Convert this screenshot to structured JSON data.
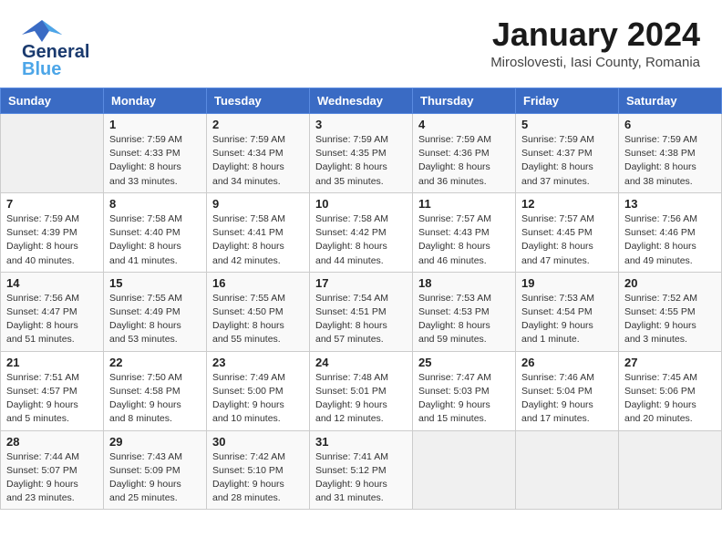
{
  "header": {
    "logo_line1": "General",
    "logo_line2": "Blue",
    "month": "January 2024",
    "location": "Miroslovesti, Iasi County, Romania"
  },
  "weekdays": [
    "Sunday",
    "Monday",
    "Tuesday",
    "Wednesday",
    "Thursday",
    "Friday",
    "Saturday"
  ],
  "weeks": [
    [
      {
        "day": "",
        "sunrise": "",
        "sunset": "",
        "daylight": ""
      },
      {
        "day": "1",
        "sunrise": "Sunrise: 7:59 AM",
        "sunset": "Sunset: 4:33 PM",
        "daylight": "Daylight: 8 hours and 33 minutes."
      },
      {
        "day": "2",
        "sunrise": "Sunrise: 7:59 AM",
        "sunset": "Sunset: 4:34 PM",
        "daylight": "Daylight: 8 hours and 34 minutes."
      },
      {
        "day": "3",
        "sunrise": "Sunrise: 7:59 AM",
        "sunset": "Sunset: 4:35 PM",
        "daylight": "Daylight: 8 hours and 35 minutes."
      },
      {
        "day": "4",
        "sunrise": "Sunrise: 7:59 AM",
        "sunset": "Sunset: 4:36 PM",
        "daylight": "Daylight: 8 hours and 36 minutes."
      },
      {
        "day": "5",
        "sunrise": "Sunrise: 7:59 AM",
        "sunset": "Sunset: 4:37 PM",
        "daylight": "Daylight: 8 hours and 37 minutes."
      },
      {
        "day": "6",
        "sunrise": "Sunrise: 7:59 AM",
        "sunset": "Sunset: 4:38 PM",
        "daylight": "Daylight: 8 hours and 38 minutes."
      }
    ],
    [
      {
        "day": "7",
        "sunrise": "Sunrise: 7:59 AM",
        "sunset": "Sunset: 4:39 PM",
        "daylight": "Daylight: 8 hours and 40 minutes."
      },
      {
        "day": "8",
        "sunrise": "Sunrise: 7:58 AM",
        "sunset": "Sunset: 4:40 PM",
        "daylight": "Daylight: 8 hours and 41 minutes."
      },
      {
        "day": "9",
        "sunrise": "Sunrise: 7:58 AM",
        "sunset": "Sunset: 4:41 PM",
        "daylight": "Daylight: 8 hours and 42 minutes."
      },
      {
        "day": "10",
        "sunrise": "Sunrise: 7:58 AM",
        "sunset": "Sunset: 4:42 PM",
        "daylight": "Daylight: 8 hours and 44 minutes."
      },
      {
        "day": "11",
        "sunrise": "Sunrise: 7:57 AM",
        "sunset": "Sunset: 4:43 PM",
        "daylight": "Daylight: 8 hours and 46 minutes."
      },
      {
        "day": "12",
        "sunrise": "Sunrise: 7:57 AM",
        "sunset": "Sunset: 4:45 PM",
        "daylight": "Daylight: 8 hours and 47 minutes."
      },
      {
        "day": "13",
        "sunrise": "Sunrise: 7:56 AM",
        "sunset": "Sunset: 4:46 PM",
        "daylight": "Daylight: 8 hours and 49 minutes."
      }
    ],
    [
      {
        "day": "14",
        "sunrise": "Sunrise: 7:56 AM",
        "sunset": "Sunset: 4:47 PM",
        "daylight": "Daylight: 8 hours and 51 minutes."
      },
      {
        "day": "15",
        "sunrise": "Sunrise: 7:55 AM",
        "sunset": "Sunset: 4:49 PM",
        "daylight": "Daylight: 8 hours and 53 minutes."
      },
      {
        "day": "16",
        "sunrise": "Sunrise: 7:55 AM",
        "sunset": "Sunset: 4:50 PM",
        "daylight": "Daylight: 8 hours and 55 minutes."
      },
      {
        "day": "17",
        "sunrise": "Sunrise: 7:54 AM",
        "sunset": "Sunset: 4:51 PM",
        "daylight": "Daylight: 8 hours and 57 minutes."
      },
      {
        "day": "18",
        "sunrise": "Sunrise: 7:53 AM",
        "sunset": "Sunset: 4:53 PM",
        "daylight": "Daylight: 8 hours and 59 minutes."
      },
      {
        "day": "19",
        "sunrise": "Sunrise: 7:53 AM",
        "sunset": "Sunset: 4:54 PM",
        "daylight": "Daylight: 9 hours and 1 minute."
      },
      {
        "day": "20",
        "sunrise": "Sunrise: 7:52 AM",
        "sunset": "Sunset: 4:55 PM",
        "daylight": "Daylight: 9 hours and 3 minutes."
      }
    ],
    [
      {
        "day": "21",
        "sunrise": "Sunrise: 7:51 AM",
        "sunset": "Sunset: 4:57 PM",
        "daylight": "Daylight: 9 hours and 5 minutes."
      },
      {
        "day": "22",
        "sunrise": "Sunrise: 7:50 AM",
        "sunset": "Sunset: 4:58 PM",
        "daylight": "Daylight: 9 hours and 8 minutes."
      },
      {
        "day": "23",
        "sunrise": "Sunrise: 7:49 AM",
        "sunset": "Sunset: 5:00 PM",
        "daylight": "Daylight: 9 hours and 10 minutes."
      },
      {
        "day": "24",
        "sunrise": "Sunrise: 7:48 AM",
        "sunset": "Sunset: 5:01 PM",
        "daylight": "Daylight: 9 hours and 12 minutes."
      },
      {
        "day": "25",
        "sunrise": "Sunrise: 7:47 AM",
        "sunset": "Sunset: 5:03 PM",
        "daylight": "Daylight: 9 hours and 15 minutes."
      },
      {
        "day": "26",
        "sunrise": "Sunrise: 7:46 AM",
        "sunset": "Sunset: 5:04 PM",
        "daylight": "Daylight: 9 hours and 17 minutes."
      },
      {
        "day": "27",
        "sunrise": "Sunrise: 7:45 AM",
        "sunset": "Sunset: 5:06 PM",
        "daylight": "Daylight: 9 hours and 20 minutes."
      }
    ],
    [
      {
        "day": "28",
        "sunrise": "Sunrise: 7:44 AM",
        "sunset": "Sunset: 5:07 PM",
        "daylight": "Daylight: 9 hours and 23 minutes."
      },
      {
        "day": "29",
        "sunrise": "Sunrise: 7:43 AM",
        "sunset": "Sunset: 5:09 PM",
        "daylight": "Daylight: 9 hours and 25 minutes."
      },
      {
        "day": "30",
        "sunrise": "Sunrise: 7:42 AM",
        "sunset": "Sunset: 5:10 PM",
        "daylight": "Daylight: 9 hours and 28 minutes."
      },
      {
        "day": "31",
        "sunrise": "Sunrise: 7:41 AM",
        "sunset": "Sunset: 5:12 PM",
        "daylight": "Daylight: 9 hours and 31 minutes."
      },
      {
        "day": "",
        "sunrise": "",
        "sunset": "",
        "daylight": ""
      },
      {
        "day": "",
        "sunrise": "",
        "sunset": "",
        "daylight": ""
      },
      {
        "day": "",
        "sunrise": "",
        "sunset": "",
        "daylight": ""
      }
    ]
  ]
}
